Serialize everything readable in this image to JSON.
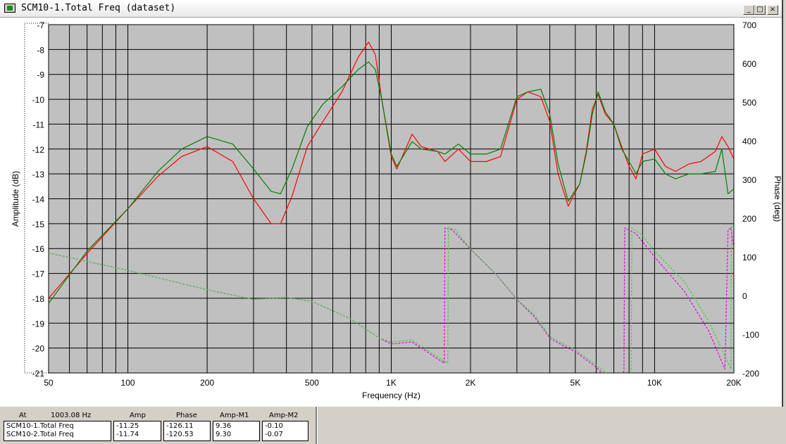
{
  "window": {
    "title": "SCM10-1.Total Freq (dataset)",
    "controls": {
      "minimize": "_",
      "maximize": "□",
      "close": "×"
    }
  },
  "chart_data": {
    "type": "line",
    "xscale": "log",
    "xlim": [
      50,
      20000
    ],
    "ylim": [
      -21,
      -7
    ],
    "y2lim": [
      -200,
      700
    ],
    "xlabel": "Frequency (Hz)",
    "ylabel": "Amplitude (dB)",
    "y2label": "Phase (deg)",
    "xticks": [
      {
        "value": 50,
        "label": "50"
      },
      {
        "value": 100,
        "label": "100"
      },
      {
        "value": 200,
        "label": "200"
      },
      {
        "value": 500,
        "label": "500"
      },
      {
        "value": 1000,
        "label": "1K"
      },
      {
        "value": 2000,
        "label": "2K"
      },
      {
        "value": 5000,
        "label": "5K"
      },
      {
        "value": 10000,
        "label": "10K"
      },
      {
        "value": 20000,
        "label": "20K"
      }
    ],
    "yticks": [
      {
        "value": -7,
        "label": "-7"
      },
      {
        "value": -8,
        "label": "-8"
      },
      {
        "value": -9,
        "label": "-9"
      },
      {
        "value": -10,
        "label": "-10"
      },
      {
        "value": -11,
        "label": "-11"
      },
      {
        "value": -12,
        "label": "-12"
      },
      {
        "value": -13,
        "label": "-13"
      },
      {
        "value": -14,
        "label": "-14"
      },
      {
        "value": -15,
        "label": "-15"
      },
      {
        "value": -16,
        "label": "-16"
      },
      {
        "value": -17,
        "label": "-17"
      },
      {
        "value": -18,
        "label": "-18"
      },
      {
        "value": -19,
        "label": "-19"
      },
      {
        "value": -20,
        "label": "-20"
      },
      {
        "value": -21,
        "label": "-21"
      }
    ],
    "y2ticks": [
      {
        "value": 700,
        "label": "700"
      },
      {
        "value": 600,
        "label": "600"
      },
      {
        "value": 500,
        "label": "500"
      },
      {
        "value": 400,
        "label": "400"
      },
      {
        "value": 300,
        "label": "300"
      },
      {
        "value": 200,
        "label": "200"
      },
      {
        "value": 100,
        "label": "100"
      },
      {
        "value": 0,
        "label": "0"
      },
      {
        "value": -100,
        "label": "-100"
      },
      {
        "value": -200,
        "label": "-200"
      }
    ],
    "grid": true,
    "series": [
      {
        "axis": "left",
        "color": "#ff0000",
        "style": "solid",
        "x": [
          50,
          70,
          100,
          130,
          160,
          200,
          250,
          300,
          350,
          380,
          420,
          480,
          550,
          650,
          750,
          820,
          870,
          920,
          1000,
          1050,
          1200,
          1300,
          1500,
          1600,
          1800,
          2000,
          2300,
          2600,
          3000,
          3300,
          3700,
          4000,
          4300,
          4700,
          4900,
          5200,
          5500,
          5800,
          6100,
          6500,
          7000,
          7500,
          8000,
          8500,
          9000,
          10000,
          11000,
          12000,
          13500,
          15000,
          17000,
          18000,
          19000,
          20000
        ],
        "y": [
          -18.0,
          -16.2,
          -14.4,
          -13.1,
          -12.3,
          -11.9,
          -12.5,
          -14.0,
          -15.0,
          -15.0,
          -13.9,
          -11.9,
          -10.9,
          -9.7,
          -8.3,
          -7.7,
          -8.2,
          -10.0,
          -12.3,
          -12.8,
          -11.4,
          -11.9,
          -12.1,
          -12.5,
          -12.0,
          -12.5,
          -12.5,
          -12.3,
          -10.0,
          -9.7,
          -9.9,
          -10.9,
          -13.0,
          -14.3,
          -13.9,
          -13.4,
          -12.1,
          -10.4,
          -9.8,
          -10.6,
          -11.0,
          -11.9,
          -12.7,
          -13.2,
          -12.2,
          -12.0,
          -12.7,
          -12.9,
          -12.6,
          -12.5,
          -12.1,
          -11.5,
          -11.9,
          -12.4
        ]
      },
      {
        "axis": "left",
        "color": "#008000",
        "style": "solid",
        "x": [
          50,
          70,
          100,
          130,
          160,
          200,
          250,
          300,
          350,
          380,
          420,
          480,
          550,
          650,
          750,
          820,
          870,
          920,
          1000,
          1050,
          1200,
          1300,
          1500,
          1600,
          1800,
          2000,
          2300,
          2600,
          3000,
          3300,
          3700,
          4000,
          4300,
          4700,
          4900,
          5200,
          5500,
          5800,
          6100,
          6500,
          7000,
          7500,
          8000,
          8500,
          9000,
          10000,
          11000,
          12000,
          13500,
          15000,
          17000,
          18000,
          19000,
          20000
        ],
        "y": [
          -18.2,
          -16.1,
          -14.4,
          -12.9,
          -12.0,
          -11.5,
          -11.8,
          -12.8,
          -13.7,
          -13.8,
          -12.8,
          -11.1,
          -10.2,
          -9.5,
          -8.8,
          -8.5,
          -8.8,
          -10.0,
          -12.2,
          -12.7,
          -11.7,
          -12.0,
          -12.1,
          -12.2,
          -11.8,
          -12.2,
          -12.2,
          -12.0,
          -9.9,
          -9.7,
          -9.6,
          -10.6,
          -12.6,
          -14.1,
          -13.8,
          -13.4,
          -12.2,
          -10.6,
          -9.7,
          -10.5,
          -11.0,
          -12.0,
          -12.5,
          -13.0,
          -12.5,
          -12.4,
          -13.0,
          -13.2,
          -13.0,
          -13.0,
          -12.9,
          -12.0,
          -13.8,
          -13.6
        ]
      },
      {
        "axis": "right",
        "color": "#e000e0",
        "style": "dashed",
        "x": [
          50,
          100,
          200,
          300,
          400,
          500,
          700,
          900,
          1000,
          1200,
          1400,
          1590,
          1600,
          1700,
          2000,
          2500,
          3000,
          3500,
          4000,
          4500,
          5000,
          6000,
          7000,
          7650,
          7700,
          8500,
          10000,
          13000,
          16000,
          18500,
          19000,
          19500,
          20000
        ],
        "y": [
          110,
          65,
          15,
          -10,
          -5,
          -15,
          -60,
          -110,
          -125,
          -120,
          -150,
          -175,
          175,
          170,
          120,
          55,
          -10,
          -55,
          -110,
          -130,
          -145,
          -185,
          -230,
          -195,
          175,
          160,
          100,
          10,
          -90,
          -190,
          170,
          175,
          120
        ]
      },
      {
        "axis": "right",
        "color": "#44cc44",
        "style": "dashed",
        "x": [
          50,
          100,
          200,
          300,
          400,
          500,
          700,
          900,
          1000,
          1200,
          1400,
          1640,
          1650,
          1750,
          2000,
          2500,
          3000,
          3500,
          4000,
          4500,
          5000,
          6000,
          7000,
          8150,
          8200,
          9000,
          10000,
          13000,
          16000,
          19500,
          19600,
          20000
        ],
        "y": [
          110,
          65,
          15,
          -10,
          -5,
          -15,
          -60,
          -110,
          -120,
          -115,
          -145,
          -175,
          175,
          170,
          120,
          55,
          -10,
          -50,
          -105,
          -125,
          -140,
          -180,
          -215,
          -200,
          175,
          155,
          115,
          35,
          -65,
          -190,
          180,
          175
        ]
      }
    ]
  },
  "status": {
    "at_label": "At",
    "at_value": "1003.08 Hz",
    "headers": {
      "amp": "Amp",
      "phase": "Phase",
      "amp_m1": "Amp-M1",
      "amp_m2": "Amp-M2"
    },
    "rows": [
      {
        "name": "SCM10-1.Total Freq",
        "amp": "-11.25",
        "phase": "-126.11",
        "amp_m1": "9.36",
        "amp_m2": "-0.10"
      },
      {
        "name": "SCM10-2.Total Freq",
        "amp": "-11.74",
        "phase": "-120.53",
        "amp_m1": "9.30",
        "amp_m2": "-0.07"
      }
    ]
  }
}
